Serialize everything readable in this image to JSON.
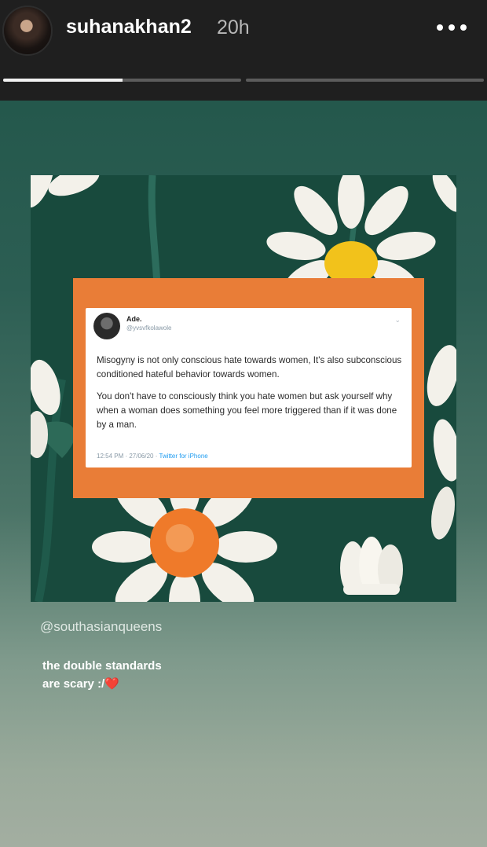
{
  "header": {
    "username": "suhanakhan2",
    "time": "20h",
    "more_icon": "more-horizontal-icon",
    "progress": [
      {
        "fill": 0.5
      },
      {
        "fill": 0
      }
    ]
  },
  "tweet": {
    "name": "Ade.",
    "handle": "@yvsvfkolawole",
    "paragraph1": "Misogyny is not only conscious hate towards women, It's also subconscious conditioned hateful behavior towards women.",
    "paragraph2": "You don't have to consciously think you hate women but ask yourself why when a woman does something you feel more triggered than if it was done by a man.",
    "meta": "12:54 PM · 27/06/20 · ",
    "source": "Twitter for iPhone"
  },
  "mention": "@southasianqueens",
  "caption": {
    "line1": "the double standards",
    "line2": "are scary :/",
    "emoji": "❤️"
  },
  "colors": {
    "story_top": "#24584c",
    "story_bottom": "#a3aea1",
    "card": "#e97d37",
    "daisy_center_yellow": "#f2c21b",
    "daisy_center_orange": "#ef7a2a"
  }
}
